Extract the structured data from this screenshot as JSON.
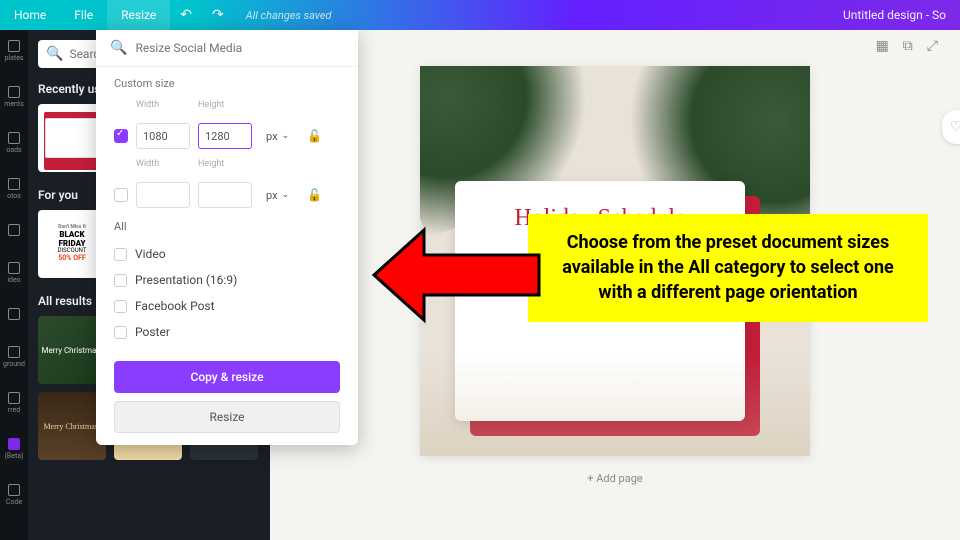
{
  "topbar": {
    "home": "Home",
    "file": "File",
    "resize": "Resize",
    "save_status": "All changes saved",
    "title": "Untitled design - So"
  },
  "rail": {
    "items": [
      "plates",
      "ments",
      "oads",
      "otos",
      "",
      "ideo",
      "",
      "ground",
      "rred",
      "(Beta)",
      "Code"
    ]
  },
  "side": {
    "search_placeholder": "Searc",
    "recent_title": "Recently us",
    "foryou_title": "For you",
    "allresults_title": "All results",
    "bf_line1": "BLACK",
    "bf_line2": "FRIDAY",
    "bf_disc": "DISCOUNT",
    "bf_off": "50% OFF",
    "merry": "Merry Christmas!"
  },
  "resize_panel": {
    "search_placeholder": "Resize Social Media",
    "custom_label": "Custom size",
    "width_label": "Width",
    "height_label": "Height",
    "row1": {
      "width": "1080",
      "height": "1280"
    },
    "row2": {
      "width": "",
      "height": ""
    },
    "unit": "px",
    "all_label": "All",
    "presets": [
      "Video",
      "Presentation (16:9)",
      "Facebook Post",
      "Poster"
    ],
    "copy_resize": "Copy & resize",
    "resize_btn": "Resize"
  },
  "canvas": {
    "holiday_title": "Holiday Schedule",
    "add_page": "+ Add page"
  },
  "annotation": {
    "text": "Choose from the preset document sizes available in the All category to select one with a different page orientation"
  }
}
